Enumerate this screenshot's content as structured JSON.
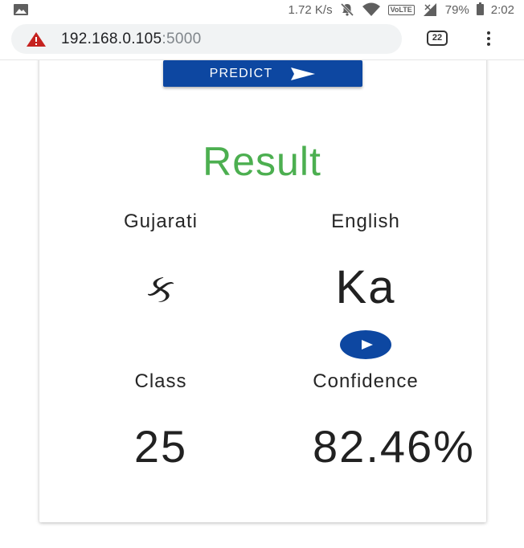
{
  "status_bar": {
    "speed": "1.72 K/s",
    "volte": "VoLTE",
    "battery": "79%",
    "time": "2:02"
  },
  "browser": {
    "url_host": "192.168.0.105",
    "url_port": ":5000",
    "tab_count": "22"
  },
  "predict": {
    "label": "PREDICT"
  },
  "result": {
    "title": "Result",
    "gujarati_label": "Gujarati",
    "english_label": "English",
    "gujarati_value": "ક",
    "english_value": "Ka",
    "class_label": "Class",
    "confidence_label": "Confidence",
    "class_value": "25",
    "confidence_value": "82.46%"
  },
  "colors": {
    "accent_blue": "#0d47a1",
    "result_green": "#4caf50"
  },
  "icons": [
    "image-icon",
    "mute-icon",
    "wifi-icon",
    "signal-icon",
    "battery-icon",
    "warning-icon",
    "tabs-icon",
    "menu-icon",
    "send-icon",
    "play-icon"
  ]
}
